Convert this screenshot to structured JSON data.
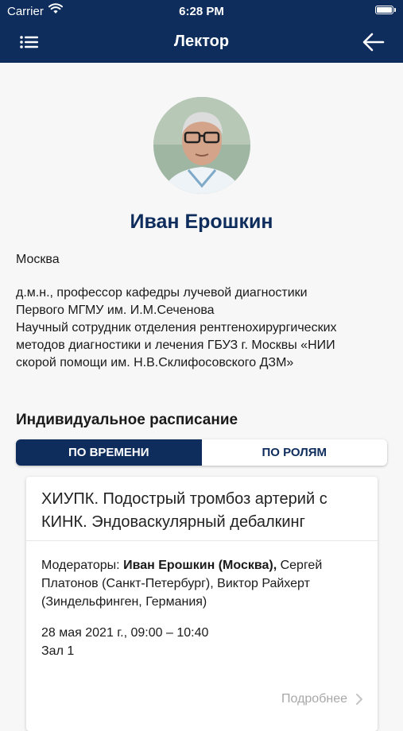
{
  "status_bar": {
    "carrier": "Carrier",
    "time": "6:28 PM"
  },
  "nav": {
    "title": "Лектор",
    "menu_icon": "menu-icon",
    "back_icon": "arrow-left-icon"
  },
  "colors": {
    "brand": "#0e2d5c",
    "muted": "#a8a8a8"
  },
  "profile": {
    "name": "Иван Ерошкин",
    "city": "Москва",
    "bio": "д.м.н., профессор кафедры лучевой диагностики\nПервого МГМУ им. И.М.Сеченова\nНаучный сотрудник отделения рентгенохирургических\nметодов диагностики и лечения ГБУЗ г. Москвы «НИИ\nскорой помощи им. Н.В.Склифосовского ДЗМ»"
  },
  "schedule": {
    "title": "Индивидуальное расписание",
    "tabs": [
      {
        "label": "ПО ВРЕМЕНИ",
        "active": true
      },
      {
        "label": "ПО РОЛЯМ",
        "active": false
      }
    ]
  },
  "session": {
    "title": "ХИУПК. Подострый тромбоз артерий с КИНК. Эндоваскулярный дебалкинг",
    "moderators_prefix": "Модераторы: ",
    "moderator_bold": "Иван Ерошкин (Москва),",
    "moderators_rest": " Сергей Платонов (Санкт-Петербург), Виктор Райхерт (Зиндельфинген, Германия)",
    "date_time": "28 мая 2021 г., 09:00 – 10:40",
    "hall": "Зал 1",
    "more_label": "Подробнее"
  }
}
